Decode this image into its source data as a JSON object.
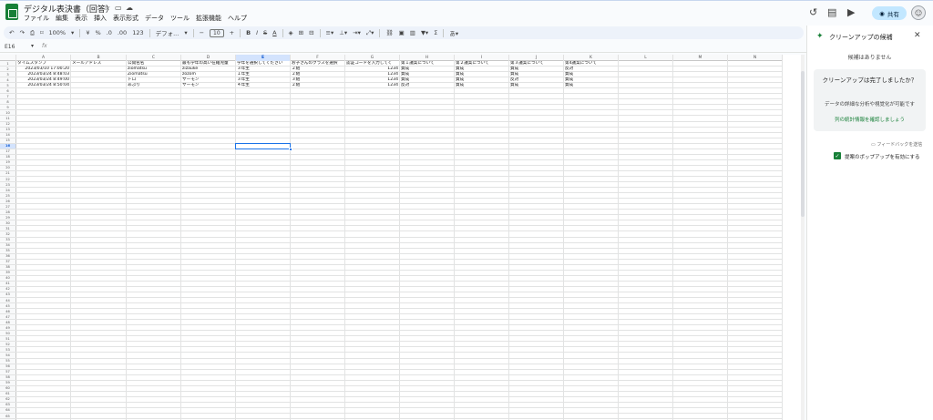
{
  "doc": {
    "title": "デジタル表決書（回答）"
  },
  "menu": [
    "ファイル",
    "編集",
    "表示",
    "挿入",
    "表示形式",
    "データ",
    "ツール",
    "拡張機能",
    "ヘルプ"
  ],
  "toolbar": {
    "zoom": "100%",
    "currency": "¥",
    "percent": "%",
    "dec_dec": ".0",
    "dec_inc": ".00",
    "numfmt": "123",
    "font": "デフォ...",
    "font_size": "10",
    "bold": "B",
    "italic": "I"
  },
  "share": {
    "label": "共有"
  },
  "formula": {
    "namebox": "E16",
    "fx": "fx"
  },
  "sheet": {
    "columns": [
      "A",
      "B",
      "C",
      "D",
      "E",
      "F",
      "G",
      "H",
      "I",
      "J",
      "K",
      "L",
      "M",
      "N"
    ],
    "headers": [
      "タイムスタンプ",
      "メールアドレス",
      "公開名名",
      "最も学年の高い在籍児童",
      "学年を選択してください",
      "お子さんのクラスを選択",
      "認証コードを入力してく",
      "第１議案について",
      "第２議案について",
      "第３議案について",
      "第4議案について",
      "",
      ""
    ],
    "data_rows": [
      [
        "2023/03/10 17:00:20",
        "",
        "ziomatsu",
        "zizauke",
        "３年生",
        "２組",
        "1234",
        "賛成",
        "賛成",
        "賛成",
        "反対"
      ],
      [
        "2023/03/24 8:48:03",
        "",
        "Ziomatsu",
        "zozom",
        "１年生",
        "２組",
        "1234",
        "賛成",
        "賛成",
        "賛成",
        "賛成"
      ],
      [
        "2023/03/24 8:49:00",
        "",
        "トロ",
        "サーモン",
        "３年生",
        "３組",
        "1234",
        "賛成",
        "賛成",
        "反対",
        "賛成"
      ],
      [
        "2023/03/24 8:50:04",
        "",
        "あぶり",
        "サーモン",
        "４年生",
        "２組",
        "1234",
        "反対",
        "賛成",
        "賛成",
        "賛成"
      ]
    ],
    "row_count": 66,
    "selected_cell": "E16"
  },
  "panel": {
    "title": "クリーンアップの候補",
    "no_suggestions": "候補はありません",
    "done_question": "クリーンアップは完了しましたか？",
    "done_desc": "データの詳細な分析や視覚化が可能です",
    "link": "列の統計情報を確認しましょう",
    "feedback": "フィードバックを送信",
    "popup_label": "提案のポップアップを有効にする"
  },
  "colors": {
    "accent": "#1a73e8",
    "sheets_green": "#188038",
    "share_bg": "#c2e7ff"
  }
}
